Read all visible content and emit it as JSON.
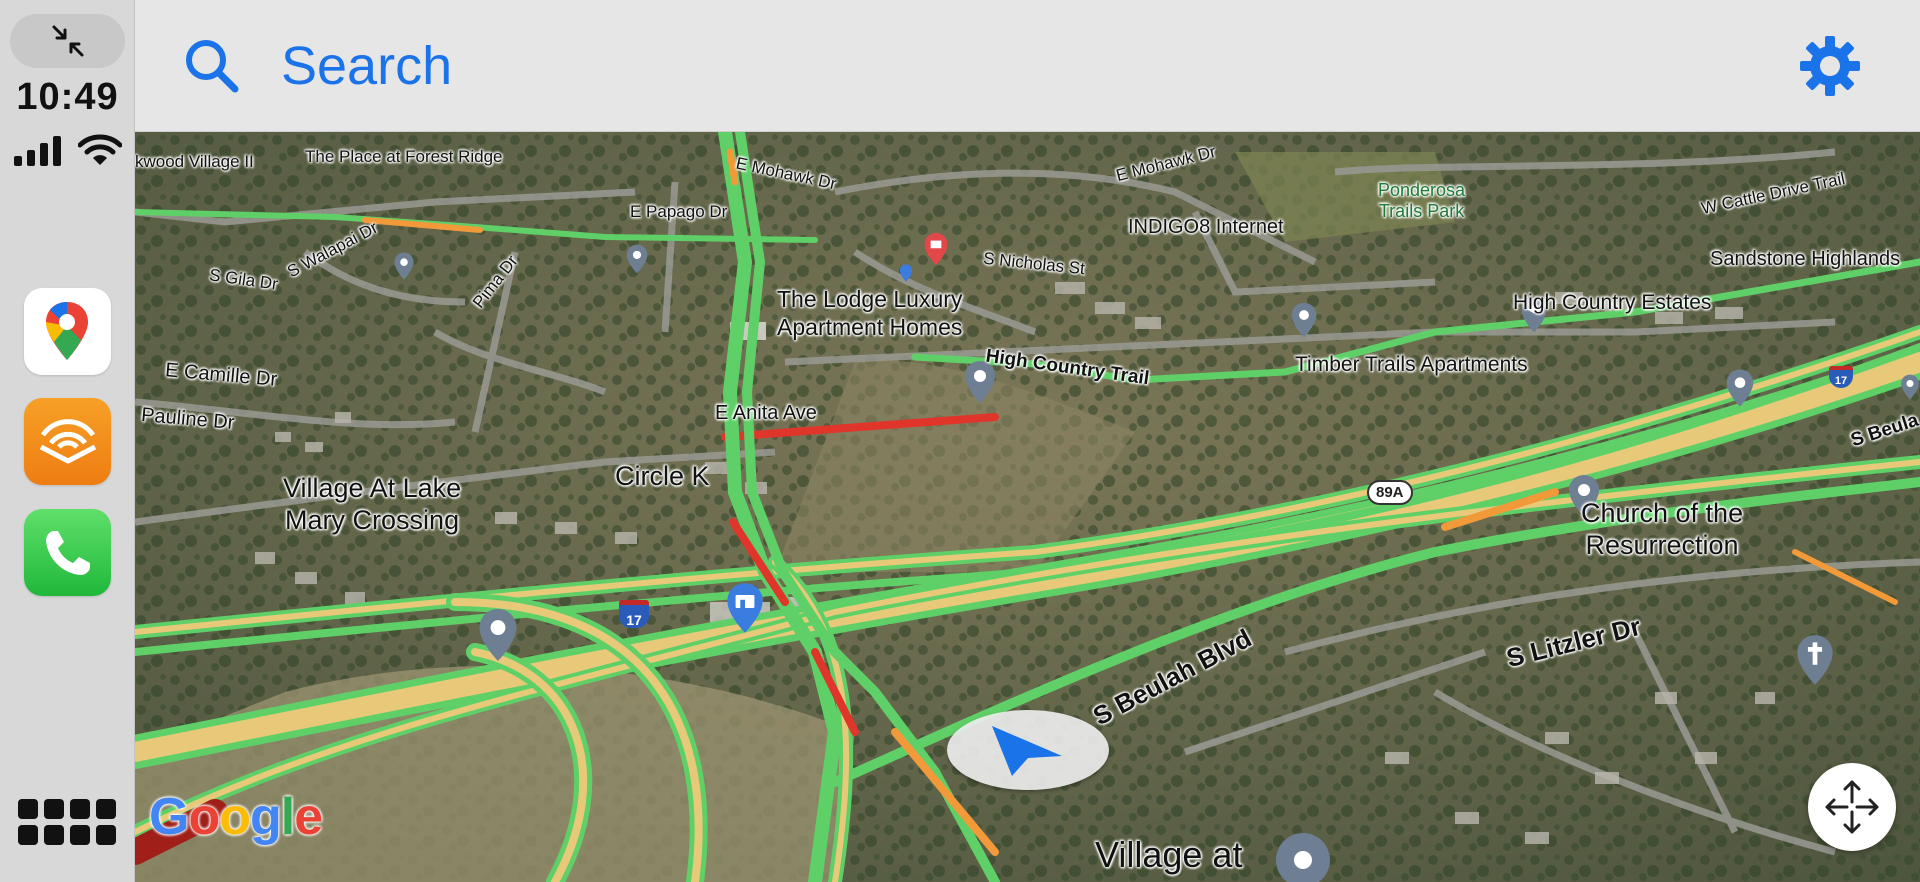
{
  "status": {
    "time": "10:49"
  },
  "sidebar": {
    "apps": [
      {
        "name": "Google Maps",
        "icon": "google-maps-icon"
      },
      {
        "name": "Audible",
        "icon": "audible-icon"
      },
      {
        "name": "Phone",
        "icon": "phone-icon"
      }
    ],
    "dashboard_icon": "app-grid-icon",
    "minimize_icon": "minimize-arrows-icon"
  },
  "header": {
    "search_label": "Search",
    "search_icon": "search-icon",
    "settings_icon": "gear-icon",
    "accent_color": "#1a73e8"
  },
  "map": {
    "poi_labels": {
      "oakwood": "kwood Village II",
      "forest_ridge": "The Place at Forest Ridge",
      "lodge_line1": "The Lodge Luxury",
      "lodge_line2": "Apartment Homes",
      "indigo": "INDIGO8 Internet",
      "ponderosa_line1": "Ponderosa",
      "ponderosa_line2": "Trails Park",
      "high_country_estates": "High Country Estates",
      "sandstone": "Sandstone Highlands",
      "timber_trails": "Timber Trails Apartments",
      "circle_k": "Circle K",
      "village_lake_line1": "Village At Lake",
      "village_lake_line2": "Mary Crossing",
      "church_line1": "Church of the",
      "church_line2": "Resurrection",
      "village_at": "Village at"
    },
    "road_labels": {
      "e_mohawk_1": "E Mohawk Dr",
      "e_mohawk_2": "E Mohawk Dr",
      "e_papago": "E Papago Dr",
      "s_walapai": "S Walapai Dr",
      "pima": "Pima Dr",
      "s_gila": "S Gila Dr",
      "s_nicholas": "S Nicholas St",
      "w_cattle": "W Cattle Drive Trail",
      "e_camille": "E Camille Dr",
      "pauline": "Pauline Dr",
      "e_anita": "E Anita Ave",
      "high_country_trail": "High Country Trail",
      "s_beulah_blvd": "S Beulah Blvd",
      "s_litzler": "S Litzler Dr",
      "s_beula_edge": "S Beula",
      "route_89a": "89A",
      "i17_a": "17",
      "i17_b": "17"
    },
    "traffic_colors": {
      "fast": "#5fd068",
      "moderate": "#f29a3a",
      "slow": "#e0352b",
      "highway_core": "#e8c97a"
    },
    "attribution": "Google",
    "recenter_icon": "recenter-arrows-icon",
    "nav_icon": "navigation-arrow-icon"
  }
}
